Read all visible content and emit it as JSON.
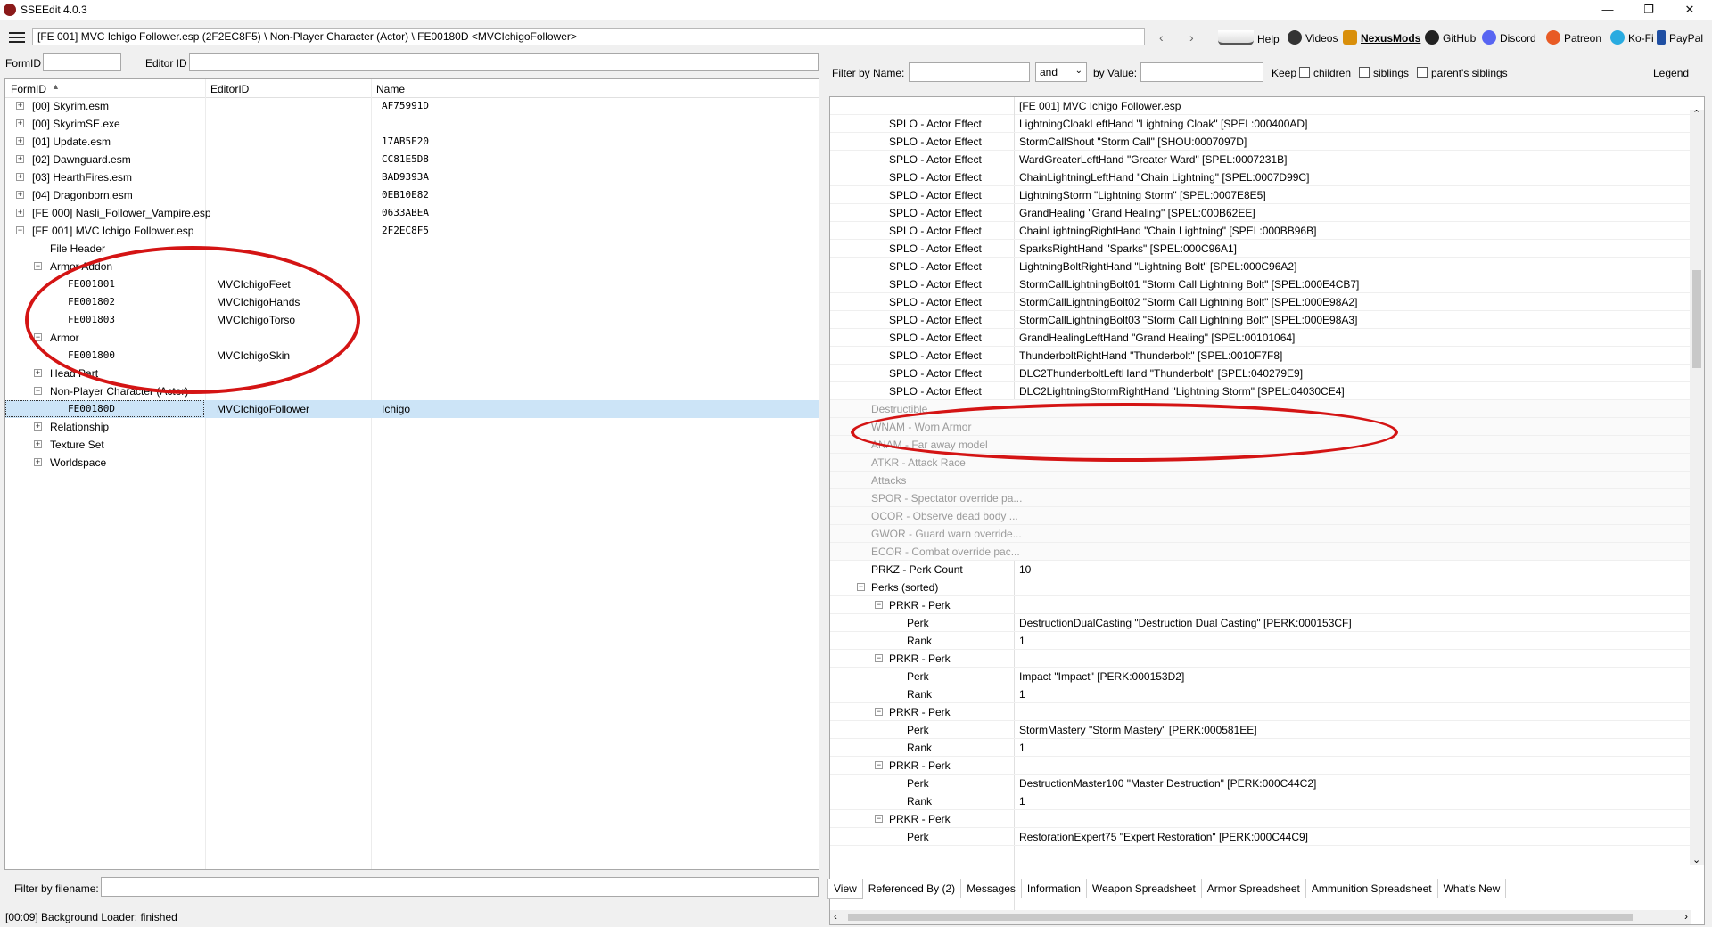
{
  "window": {
    "title": "SSEEdit 4.0.3",
    "minimize": "—",
    "maximize": "❐",
    "close": "✕"
  },
  "pathbar": {
    "path": "[FE 001] MVC Ichigo Follower.esp (2F2EC8F5) \\ Non-Player Character (Actor) \\ FE00180D <MVCIchigoFollower>",
    "back": "‹",
    "forward": "›",
    "links": {
      "help": "Help",
      "videos": "Videos",
      "nexusmods": "NexusMods",
      "github": "GitHub",
      "discord": "Discord",
      "patreon": "Patreon",
      "kofi": "Ko-Fi",
      "paypal": "PayPal"
    },
    "colors": {
      "videos": "#333333",
      "nexusmods": "#d98f0b",
      "github": "#222222",
      "discord": "#5865f2",
      "patreon": "#e85b25",
      "kofi": "#29abe0",
      "paypal": "#1f4fa3"
    }
  },
  "left": {
    "formid_label": "FormID",
    "editorid_label": "Editor ID",
    "columns": [
      "FormID",
      "EditorID",
      "Name"
    ],
    "rows": [
      {
        "indent": 0,
        "expander": "+",
        "formid": "[00] Skyrim.esm",
        "editorid": "",
        "name": "AF75991D"
      },
      {
        "indent": 0,
        "expander": "+",
        "formid": "[00] SkyrimSE.exe",
        "editorid": "",
        "name": ""
      },
      {
        "indent": 0,
        "expander": "+",
        "formid": "[01] Update.esm",
        "editorid": "",
        "name": "17AB5E20"
      },
      {
        "indent": 0,
        "expander": "+",
        "formid": "[02] Dawnguard.esm",
        "editorid": "",
        "name": "CC81E5D8"
      },
      {
        "indent": 0,
        "expander": "+",
        "formid": "[03] HearthFires.esm",
        "editorid": "",
        "name": "BAD9393A"
      },
      {
        "indent": 0,
        "expander": "+",
        "formid": "[04] Dragonborn.esm",
        "editorid": "",
        "name": "0EB10E82"
      },
      {
        "indent": 0,
        "expander": "+",
        "formid": "[FE 000] Nasli_Follower_Vampire.esp",
        "editorid": "",
        "name": "0633ABEA"
      },
      {
        "indent": 0,
        "expander": "−",
        "formid": "[FE 001] MVC Ichigo Follower.esp",
        "editorid": "",
        "name": "2F2EC8F5"
      },
      {
        "indent": 1,
        "expander": "",
        "formid": "File Header",
        "editorid": "",
        "name": ""
      },
      {
        "indent": 1,
        "expander": "−",
        "formid": "Armor Addon",
        "editorid": "",
        "name": ""
      },
      {
        "indent": 2,
        "expander": "",
        "formid": "FE001801",
        "editorid": "MVCIchigoFeet",
        "name": "",
        "mono": true
      },
      {
        "indent": 2,
        "expander": "",
        "formid": "FE001802",
        "editorid": "MVCIchigoHands",
        "name": "",
        "mono": true
      },
      {
        "indent": 2,
        "expander": "",
        "formid": "FE001803",
        "editorid": "MVCIchigoTorso",
        "name": "",
        "mono": true
      },
      {
        "indent": 1,
        "expander": "−",
        "formid": "Armor",
        "editorid": "",
        "name": ""
      },
      {
        "indent": 2,
        "expander": "",
        "formid": "FE001800",
        "editorid": "MVCIchigoSkin",
        "name": "",
        "mono": true
      },
      {
        "indent": 1,
        "expander": "+",
        "formid": "Head Part",
        "editorid": "",
        "name": ""
      },
      {
        "indent": 1,
        "expander": "−",
        "formid": "Non-Player Character (Actor)",
        "editorid": "",
        "name": ""
      },
      {
        "indent": 2,
        "expander": "",
        "formid": "FE00180D",
        "editorid": "MVCIchigoFollower",
        "name": "Ichigo",
        "mono": true,
        "selected": true
      },
      {
        "indent": 1,
        "expander": "+",
        "formid": "Relationship",
        "editorid": "",
        "name": ""
      },
      {
        "indent": 1,
        "expander": "+",
        "formid": "Texture Set",
        "editorid": "",
        "name": ""
      },
      {
        "indent": 1,
        "expander": "+",
        "formid": "Worldspace",
        "editorid": "",
        "name": ""
      }
    ],
    "filter_label": "Filter by filename:"
  },
  "right": {
    "filter_name_label": "Filter by Name:",
    "and_value": "and",
    "by_value_label": "by Value:",
    "keep_label": "Keep",
    "children_label": "children",
    "siblings_label": "siblings",
    "parents_siblings_label": "parent's siblings",
    "legend_label": "Legend",
    "header_file": "[FE 001] MVC Ichigo Follower.esp",
    "rows": [
      {
        "indent": 2,
        "label": "SPLO - Actor Effect",
        "value": "LightningCloakLeftHand \"Lightning Cloak\" [SPEL:000400AD]"
      },
      {
        "indent": 2,
        "label": "SPLO - Actor Effect",
        "value": "StormCallShout \"Storm Call\" [SHOU:0007097D]"
      },
      {
        "indent": 2,
        "label": "SPLO - Actor Effect",
        "value": "WardGreaterLeftHand \"Greater Ward\" [SPEL:0007231B]"
      },
      {
        "indent": 2,
        "label": "SPLO - Actor Effect",
        "value": "ChainLightningLeftHand \"Chain Lightning\" [SPEL:0007D99C]"
      },
      {
        "indent": 2,
        "label": "SPLO - Actor Effect",
        "value": "LightningStorm \"Lightning Storm\" [SPEL:0007E8E5]"
      },
      {
        "indent": 2,
        "label": "SPLO - Actor Effect",
        "value": "GrandHealing \"Grand Healing\" [SPEL:000B62EE]"
      },
      {
        "indent": 2,
        "label": "SPLO - Actor Effect",
        "value": "ChainLightningRightHand \"Chain Lightning\" [SPEL:000BB96B]"
      },
      {
        "indent": 2,
        "label": "SPLO - Actor Effect",
        "value": "SparksRightHand \"Sparks\" [SPEL:000C96A1]"
      },
      {
        "indent": 2,
        "label": "SPLO - Actor Effect",
        "value": "LightningBoltRightHand \"Lightning Bolt\" [SPEL:000C96A2]"
      },
      {
        "indent": 2,
        "label": "SPLO - Actor Effect",
        "value": "StormCallLightningBolt01 \"Storm Call Lightning Bolt\" [SPEL:000E4CB7]"
      },
      {
        "indent": 2,
        "label": "SPLO - Actor Effect",
        "value": "StormCallLightningBolt02 \"Storm Call Lightning Bolt\" [SPEL:000E98A2]"
      },
      {
        "indent": 2,
        "label": "SPLO - Actor Effect",
        "value": "StormCallLightningBolt03 \"Storm Call Lightning Bolt\" [SPEL:000E98A3]"
      },
      {
        "indent": 2,
        "label": "SPLO - Actor Effect",
        "value": "GrandHealingLeftHand \"Grand Healing\" [SPEL:00101064]"
      },
      {
        "indent": 2,
        "label": "SPLO - Actor Effect",
        "value": "ThunderboltRightHand \"Thunderbolt\" [SPEL:0010F7F8]"
      },
      {
        "indent": 2,
        "label": "SPLO - Actor Effect",
        "value": "DLC2ThunderboltLeftHand \"Thunderbolt\" [SPEL:040279E9]"
      },
      {
        "indent": 2,
        "label": "SPLO - Actor Effect",
        "value": "DLC2LightningStormRightHand \"Lightning Storm\" [SPEL:04030CE4]"
      },
      {
        "indent": 1,
        "label": "Destructible",
        "value": "",
        "grey": true
      },
      {
        "indent": 1,
        "label": "WNAM - Worn Armor",
        "value": "",
        "grey": true
      },
      {
        "indent": 1,
        "label": "ANAM - Far away model",
        "value": "",
        "grey": true
      },
      {
        "indent": 1,
        "label": "ATKR - Attack Race",
        "value": "",
        "grey": true
      },
      {
        "indent": 1,
        "label": "Attacks",
        "value": "",
        "grey": true
      },
      {
        "indent": 1,
        "label": "SPOR - Spectator override pa...",
        "value": "",
        "grey": true
      },
      {
        "indent": 1,
        "label": "OCOR - Observe dead body ...",
        "value": "",
        "grey": true
      },
      {
        "indent": 1,
        "label": "GWOR - Guard warn override...",
        "value": "",
        "grey": true
      },
      {
        "indent": 1,
        "label": "ECOR - Combat override pac...",
        "value": "",
        "grey": true
      },
      {
        "indent": 1,
        "label": "PRKZ - Perk Count",
        "value": "10"
      },
      {
        "indent": 1,
        "expander": "−",
        "label": "Perks (sorted)",
        "value": ""
      },
      {
        "indent": 2,
        "expander": "−",
        "label": "PRKR - Perk",
        "value": ""
      },
      {
        "indent": 3,
        "label": "Perk",
        "value": "DestructionDualCasting \"Destruction Dual Casting\" [PERK:000153CF]"
      },
      {
        "indent": 3,
        "label": "Rank",
        "value": "1"
      },
      {
        "indent": 2,
        "expander": "−",
        "label": "PRKR - Perk",
        "value": ""
      },
      {
        "indent": 3,
        "label": "Perk",
        "value": "Impact \"Impact\" [PERK:000153D2]"
      },
      {
        "indent": 3,
        "label": "Rank",
        "value": "1"
      },
      {
        "indent": 2,
        "expander": "−",
        "label": "PRKR - Perk",
        "value": ""
      },
      {
        "indent": 3,
        "label": "Perk",
        "value": "StormMastery \"Storm Mastery\" [PERK:000581EE]"
      },
      {
        "indent": 3,
        "label": "Rank",
        "value": "1"
      },
      {
        "indent": 2,
        "expander": "−",
        "label": "PRKR - Perk",
        "value": ""
      },
      {
        "indent": 3,
        "label": "Perk",
        "value": "DestructionMaster100 \"Master Destruction\" [PERK:000C44C2]"
      },
      {
        "indent": 3,
        "label": "Rank",
        "value": "1"
      },
      {
        "indent": 2,
        "expander": "−",
        "label": "PRKR - Perk",
        "value": ""
      },
      {
        "indent": 3,
        "label": "Perk",
        "value": "RestorationExpert75 \"Expert Restoration\" [PERK:000C44C9]"
      }
    ],
    "tabs": [
      "View",
      "Referenced By (2)",
      "Messages",
      "Information",
      "Weapon Spreadsheet",
      "Armor Spreadsheet",
      "Ammunition Spreadsheet",
      "What's New"
    ],
    "scroll_up": "⌃",
    "scroll_down": "⌄",
    "scroll_left": "‹",
    "scroll_right": "›"
  },
  "status": "[00:09] Background Loader: finished",
  "annotation_color": "#d41414"
}
